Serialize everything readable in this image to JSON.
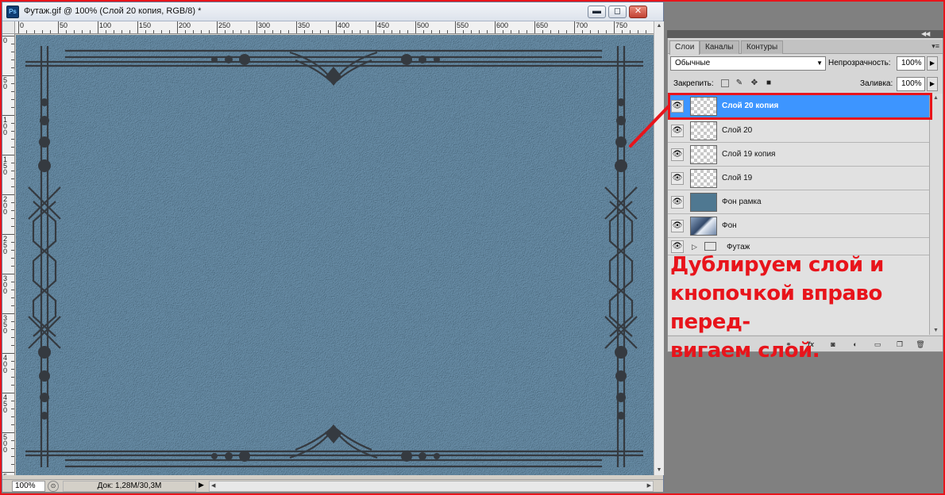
{
  "document": {
    "title": "Футаж.gif @ 100% (Слой 20 копия, RGB/8) *",
    "app_badge": "Ps",
    "window_controls": {
      "minimize": "▬",
      "restore": "◻",
      "close": "✕"
    },
    "ruler_h_labels": [
      "0",
      "50",
      "100",
      "150",
      "200",
      "250",
      "300",
      "350",
      "400",
      "450",
      "500",
      "550",
      "600",
      "650",
      "700",
      "750"
    ],
    "ruler_v_labels": [
      "0",
      "50",
      "100",
      "150",
      "200",
      "250",
      "300",
      "350",
      "400",
      "450",
      "500",
      "550"
    ],
    "canvas_color": "#53768e",
    "ornament_color": "#353a40"
  },
  "status_bar": {
    "zoom": "100%",
    "doc_info": "Док: 1,28M/30,3M",
    "arrow": "▶"
  },
  "layers_panel": {
    "tabs": [
      {
        "label": "Слои",
        "active": true
      },
      {
        "label": "Каналы",
        "active": false
      },
      {
        "label": "Контуры",
        "active": false
      }
    ],
    "blend_mode": "Обычные",
    "opacity_label": "Непрозрачность:",
    "opacity_value": "100%",
    "lock_label": "Закрепить:",
    "fill_label": "Заливка:",
    "fill_value": "100%",
    "layers": [
      {
        "name": "Слой 20 копия",
        "thumb": "transparent",
        "selected": true
      },
      {
        "name": "Слой 20",
        "thumb": "transparent",
        "selected": false
      },
      {
        "name": "Слой 19 копия",
        "thumb": "transparent",
        "selected": false
      },
      {
        "name": "Слой 19",
        "thumb": "transparent",
        "selected": false
      },
      {
        "name": "Фон рамка",
        "thumb": "solid",
        "selected": false
      },
      {
        "name": "Фон",
        "thumb": "photo",
        "selected": false
      }
    ],
    "group": {
      "name": "Футаж"
    },
    "selection_color": "#3d95ff"
  },
  "annotation": {
    "lines": [
      "Дублируем слой и",
      "кнопочкой вправо перед-",
      "вигаем слой."
    ],
    "color": "#e8141b"
  }
}
